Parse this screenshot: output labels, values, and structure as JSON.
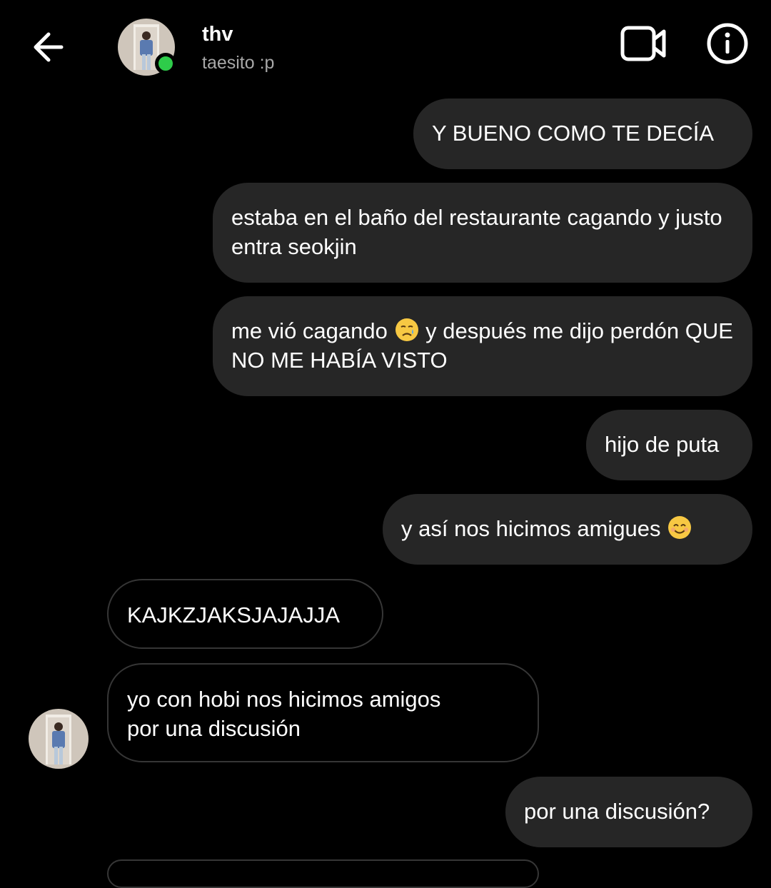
{
  "header": {
    "contact_name": "thv",
    "contact_subtitle": "taesito :p",
    "online": true,
    "icons": {
      "back": "arrow-left-icon",
      "video": "video-camera-icon",
      "info": "info-icon"
    }
  },
  "colors": {
    "background": "#000000",
    "outgoing_bubble": "#262626",
    "incoming_border": "#363636",
    "online_dot": "#2ecc4a",
    "subtitle": "#a8a8a8"
  },
  "messages": [
    {
      "from": "me",
      "text": "Y BUENO COMO TE DECÍA"
    },
    {
      "from": "me",
      "text": "estaba en el baño del restaurante cagando y justo entra seokjin"
    },
    {
      "from": "me",
      "text_before": "me vió cagando",
      "emoji": "crying-face",
      "text_after": "y después me dijo perdón QUE NO ME HABÍA VISTO"
    },
    {
      "from": "me",
      "text": "hijo de puta"
    },
    {
      "from": "me",
      "text": "y así nos hicimos amigues",
      "emoji": "smiling-face"
    },
    {
      "from": "them",
      "text": "KAJKZJAKSJAJAJJA"
    },
    {
      "from": "them",
      "text_line1": "yo con hobi nos hicimos amigos",
      "text_line2": "por una discusión"
    },
    {
      "from": "me",
      "text": "por una discusión?"
    }
  ]
}
